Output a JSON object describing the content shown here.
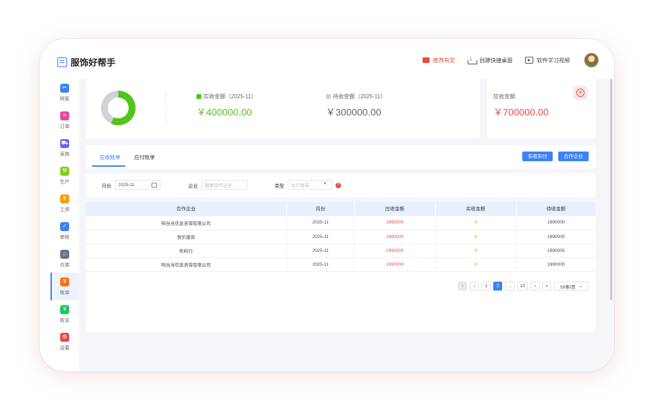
{
  "app": {
    "title": "服饰好帮手"
  },
  "top_actions": [
    {
      "label": "推荐有奖",
      "icon": "gift-icon"
    },
    {
      "label": "创建快捷桌面",
      "icon": "download-icon"
    },
    {
      "label": "软件学习视频",
      "icon": "video-icon"
    }
  ],
  "sidebar": {
    "items": [
      {
        "label": "样板",
        "icon": "scissors-icon",
        "color": "#3b82f6",
        "glyph": "✂"
      },
      {
        "label": "订单",
        "icon": "order-icon",
        "color": "#ec4899",
        "glyph": "≡"
      },
      {
        "label": "采购",
        "icon": "cart-icon",
        "color": "#6366f1",
        "glyph": "⛟"
      },
      {
        "label": "生产",
        "icon": "production-icon",
        "color": "#84cc16",
        "glyph": "⚒"
      },
      {
        "label": "工资",
        "icon": "wage-icon",
        "color": "#f59e0b",
        "glyph": "¥"
      },
      {
        "label": "审核",
        "icon": "audit-icon",
        "color": "#3b82f6",
        "glyph": "✓"
      },
      {
        "label": "仓库",
        "icon": "warehouse-icon",
        "color": "#64748b",
        "glyph": "⌂"
      },
      {
        "label": "账单",
        "icon": "bill-icon",
        "color": "#f97316",
        "glyph": "¥"
      },
      {
        "label": "收支",
        "icon": "income-icon",
        "color": "#22c55e",
        "glyph": "¥"
      },
      {
        "label": "设置",
        "icon": "settings-icon",
        "color": "#ef4444",
        "glyph": "⚙"
      }
    ],
    "active_index": 7
  },
  "summary": {
    "received_label": "实收金额（2025-11）",
    "received_value": "￥400000.00",
    "pending_label": "待收金额（2025-11）",
    "pending_value": "￥300000.00",
    "receivable_label": "应收金额",
    "receivable_value": "￥700000.00",
    "donut_received_fraction": 0.57,
    "colors": {
      "received": "#52c41a",
      "pending": "#cfd3d9"
    }
  },
  "tabs": [
    {
      "label": "应收账单",
      "active": true
    },
    {
      "label": "应付账单",
      "active": false
    }
  ],
  "buttons": {
    "received_actual": "实收实付",
    "partner": "合作企业"
  },
  "filters": {
    "month_label": "月份",
    "month_value": "2025-11",
    "company_label": "企业",
    "company_placeholder": "搜索合作企业",
    "type_label": "类型",
    "type_placeholder": "生产账单"
  },
  "table": {
    "columns": [
      "合作企业",
      "月份",
      "应收金额",
      "实收金额",
      "待收金额"
    ],
    "rows": [
      [
        "响当当信息咨询有限公司",
        "2025-11",
        "1990000",
        "0",
        "1990000"
      ],
      [
        "快乐服饰",
        "2025-11",
        "1990000",
        "0",
        "1990000"
      ],
      [
        "布料行",
        "2025-11",
        "1990000",
        "0",
        "1990000"
      ],
      [
        "响当当信息咨询有限公司",
        "2025-11",
        "1990000",
        "0",
        "1990000"
      ]
    ]
  },
  "pagination": {
    "first": "«",
    "prev": "‹",
    "pages": [
      "1",
      "2",
      "...",
      "10"
    ],
    "active_page": "2",
    "next": "›",
    "last": "»",
    "page_size": "50条/页"
  }
}
